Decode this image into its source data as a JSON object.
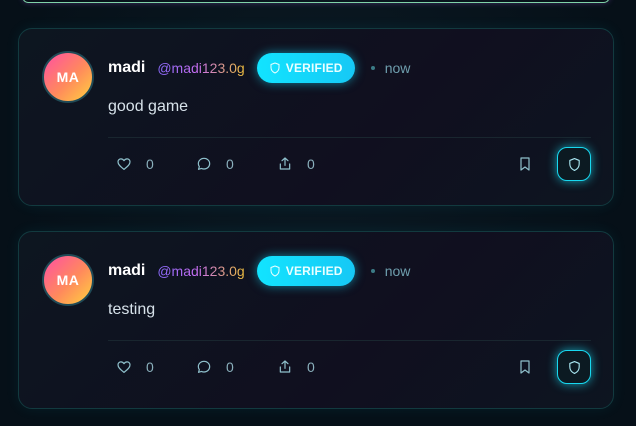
{
  "feed": {
    "posts": [
      {
        "avatar_initials": "MA",
        "author": "madi",
        "handle": "@madi123.0g",
        "badge": "VERIFIED",
        "time": "now",
        "text": "good game",
        "likes": "0",
        "comments": "0",
        "shares": "0"
      },
      {
        "avatar_initials": "MA",
        "author": "madi",
        "handle": "@madi123.0g",
        "badge": "VERIFIED",
        "time": "now",
        "text": "testing",
        "likes": "0",
        "comments": "0",
        "shares": "0"
      }
    ]
  },
  "icons": {
    "badge": "shield-icon",
    "like": "heart-icon",
    "comment": "comment-bubble-icon",
    "share": "share-upload-icon",
    "bookmark": "bookmark-icon",
    "moderate": "shield-icon"
  },
  "colors": {
    "accent": "#12e4ff",
    "avatar_gradient": [
      "#ff4fa3",
      "#ffd23f"
    ],
    "background": "#061018"
  }
}
